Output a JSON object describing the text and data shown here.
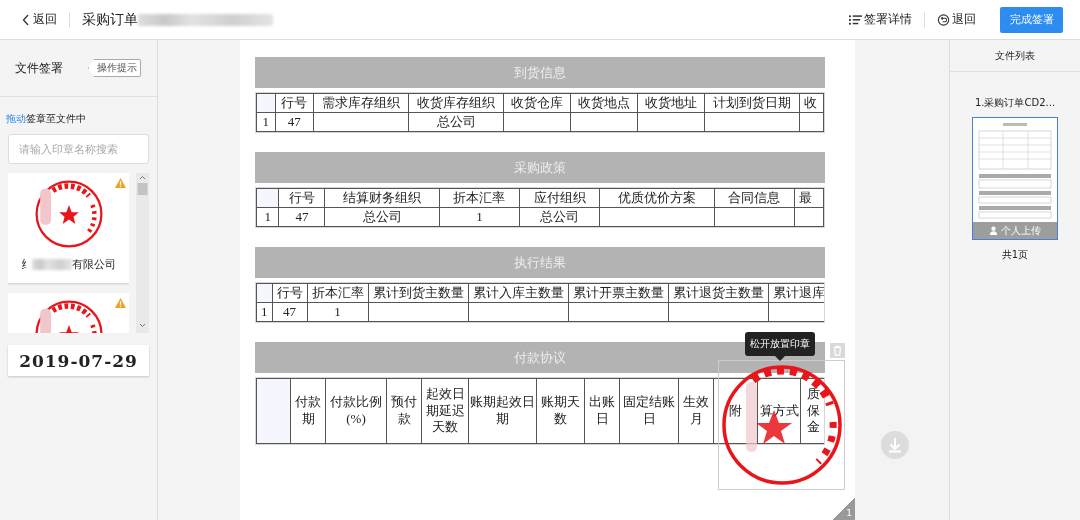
{
  "header": {
    "back": "返回",
    "title": "采购订单",
    "actions": [
      {
        "kind": "details",
        "label": "签署详情"
      },
      {
        "kind": "return",
        "label": "退回"
      }
    ],
    "primary_button": "完成签署"
  },
  "left_panel": {
    "title": "文件签署",
    "tip_button": "操作提示",
    "hint_link": "拖动",
    "hint_text": "签章至文件中",
    "search": {
      "placeholder": "请输入印章名称搜索"
    },
    "stamps": [
      {
        "caption_start": "纟",
        "caption_end": "有限公司",
        "warning": true
      },
      {
        "warning": true
      }
    ],
    "date_stamp": "2019-07-29"
  },
  "document": {
    "sections": [
      {
        "title": "到货信息",
        "columns": [
          "",
          "行号",
          "需求库存组织",
          "收货库存组织",
          "收货仓库",
          "收货地点",
          "收货地址",
          "计划到货日期",
          "收"
        ],
        "rows": [
          [
            "1",
            "47",
            "",
            "总公司",
            "",
            "",
            "",
            "",
            ""
          ]
        ]
      },
      {
        "title": "采购政策",
        "columns": [
          "",
          "行号",
          "结算财务组织",
          "折本汇率",
          "应付组织",
          "优质优价方案",
          "合同信息",
          "最"
        ],
        "rows": [
          [
            "1",
            "47",
            "总公司",
            "1",
            "总公司",
            "",
            "",
            ""
          ]
        ]
      },
      {
        "title": "执行结果",
        "columns": [
          "",
          "行号",
          "折本汇率",
          "累计到货主数量",
          "累计入库主数量",
          "累计开票主数量",
          "累计退货主数量",
          "累计退库"
        ],
        "rows": [
          [
            "1",
            "47",
            "1",
            "",
            "",
            "",
            "",
            ""
          ]
        ]
      }
    ],
    "payment": {
      "title": "付款协议",
      "columns": [
        "",
        "付款期",
        "付款比例(%)",
        "预付款",
        "起效日期延迟天数",
        "账期起效日期",
        "账期天数",
        "出账日",
        "固定结账日",
        "生效月",
        "附",
        "算方式",
        "质保金"
      ]
    },
    "dropped_stamp": {
      "tooltip": "松开放置印章"
    },
    "page_number": "1"
  },
  "file_list": {
    "title": "文件列表",
    "files": [
      {
        "name": "1.采购订单CD2...",
        "badge": "个人上传"
      }
    ],
    "page_count": "共1页"
  }
}
